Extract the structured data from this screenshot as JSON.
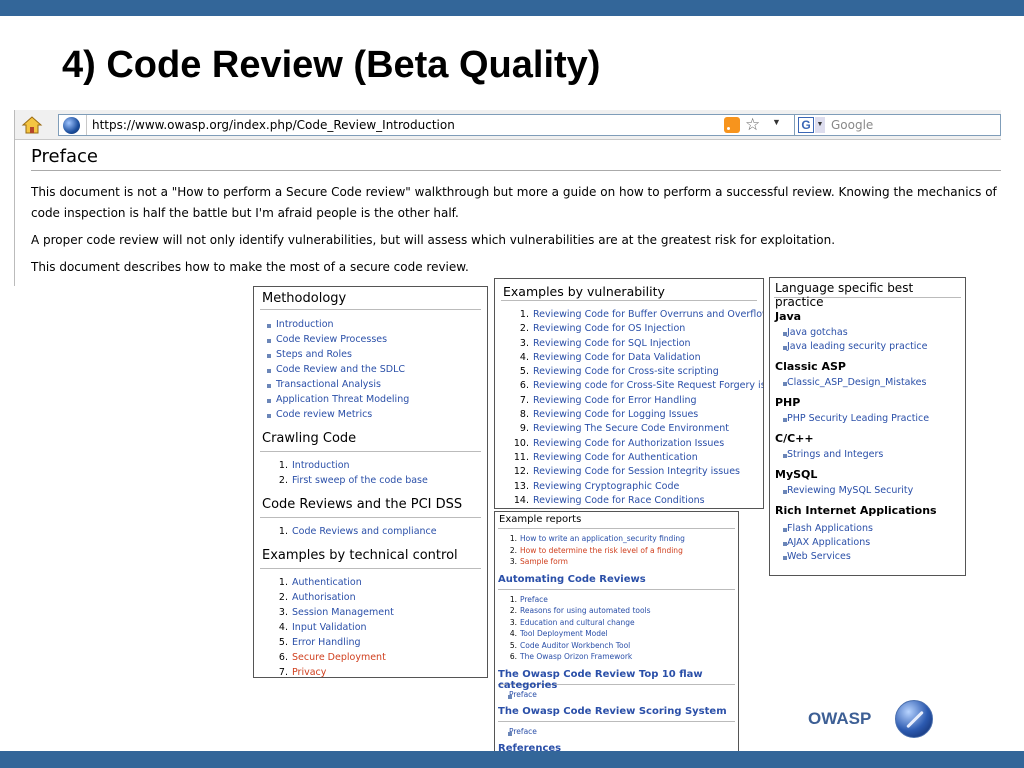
{
  "slide": {
    "title": "4) Code Review (Beta Quality)",
    "logo_text": "OWASP"
  },
  "browser": {
    "url": "https://www.owasp.org/index.php/Code_Review_Introduction",
    "search_placeholder": "Google",
    "search_engine_letter": "G"
  },
  "page": {
    "heading": "Preface",
    "paragraphs": [
      "This document is not a \"How to perform a Secure Code review\" walkthrough but more a guide on how to perform a successful review. Knowing the mechanics of code inspection is half the battle but I'm afraid people is the other half.",
      "A proper code review will not only identify vulnerabilities, but will assess which vulnerabilities are at the greatest risk for exploitation.",
      "This document describes how to make the most of a secure code review."
    ]
  },
  "methodology": {
    "heading": "Methodology",
    "items": [
      "Introduction",
      "Code Review Processes",
      "Steps and Roles",
      "Code Review and the SDLC",
      "Transactional Analysis",
      "Application Threat Modeling",
      "Code review Metrics"
    ],
    "crawling_heading": "Crawling Code",
    "crawling_items": [
      "Introduction",
      "First sweep of the code base"
    ],
    "pci_heading": "Code Reviews and the PCI DSS",
    "pci_items": [
      "Code Reviews and compliance"
    ],
    "tech_heading": "Examples by technical control",
    "tech_items": [
      "Authentication",
      "Authorisation",
      "Session Management",
      "Input Validation",
      "Error Handling",
      "Secure Deployment",
      "Privacy"
    ]
  },
  "vulnerability": {
    "heading": "Examples by vulnerability",
    "items": [
      "Reviewing Code for Buffer Overruns and Overflows",
      "Reviewing Code for OS Injection",
      "Reviewing Code for SQL Injection",
      "Reviewing Code for Data Validation",
      "Reviewing Code for Cross-site scripting",
      "Reviewing code for Cross-Site Request Forgery issues",
      "Reviewing Code for Error Handling",
      "Reviewing Code for Logging Issues",
      "Reviewing The Secure Code Environment",
      "Reviewing Code for Authorization Issues",
      "Reviewing Code for Authentication",
      "Reviewing Code for Session Integrity issues",
      "Reviewing Cryptographic Code",
      "Reviewing Code for Race Conditions"
    ]
  },
  "language": {
    "heading": "Language specific best practice",
    "java_heading": "Java",
    "java_items": [
      "Java gotchas",
      "Java leading security practice"
    ],
    "asp_heading": "Classic ASP",
    "asp_items": [
      "Classic_ASP_Design_Mistakes"
    ],
    "php_heading": "PHP",
    "php_items": [
      "PHP Security Leading Practice"
    ],
    "c_heading": "C/C++",
    "c_items": [
      "Strings and Integers"
    ],
    "mysql_heading": "MySQL",
    "mysql_items": [
      "Reviewing MySQL Security"
    ],
    "ria_heading": "Rich Internet Applications",
    "ria_items": [
      "Flash Applications",
      "AJAX Applications",
      "Web Services"
    ]
  },
  "reports": {
    "heading": "Example reports",
    "items": [
      "How to write an application_security finding",
      "How to determine the risk level of a finding",
      "Sample form"
    ],
    "automating_heading": "Automating Code Reviews",
    "automating_items": [
      "Preface",
      "Reasons for using automated tools",
      "Education and cultural change",
      "Tool Deployment Model",
      "Code Auditor Workbench Tool",
      "The Owasp Orizon Framework"
    ],
    "top10_heading": "The Owasp Code Review Top 10 flaw categories",
    "top10_items": [
      "Preface"
    ],
    "scoring_heading": "The Owasp Code Review Scoring System",
    "scoring_items": [
      "Preface"
    ],
    "references_heading": "References"
  },
  "colors": {
    "banner": "#336699",
    "link": "#2a4fa8",
    "red_link": "#d0401f"
  }
}
